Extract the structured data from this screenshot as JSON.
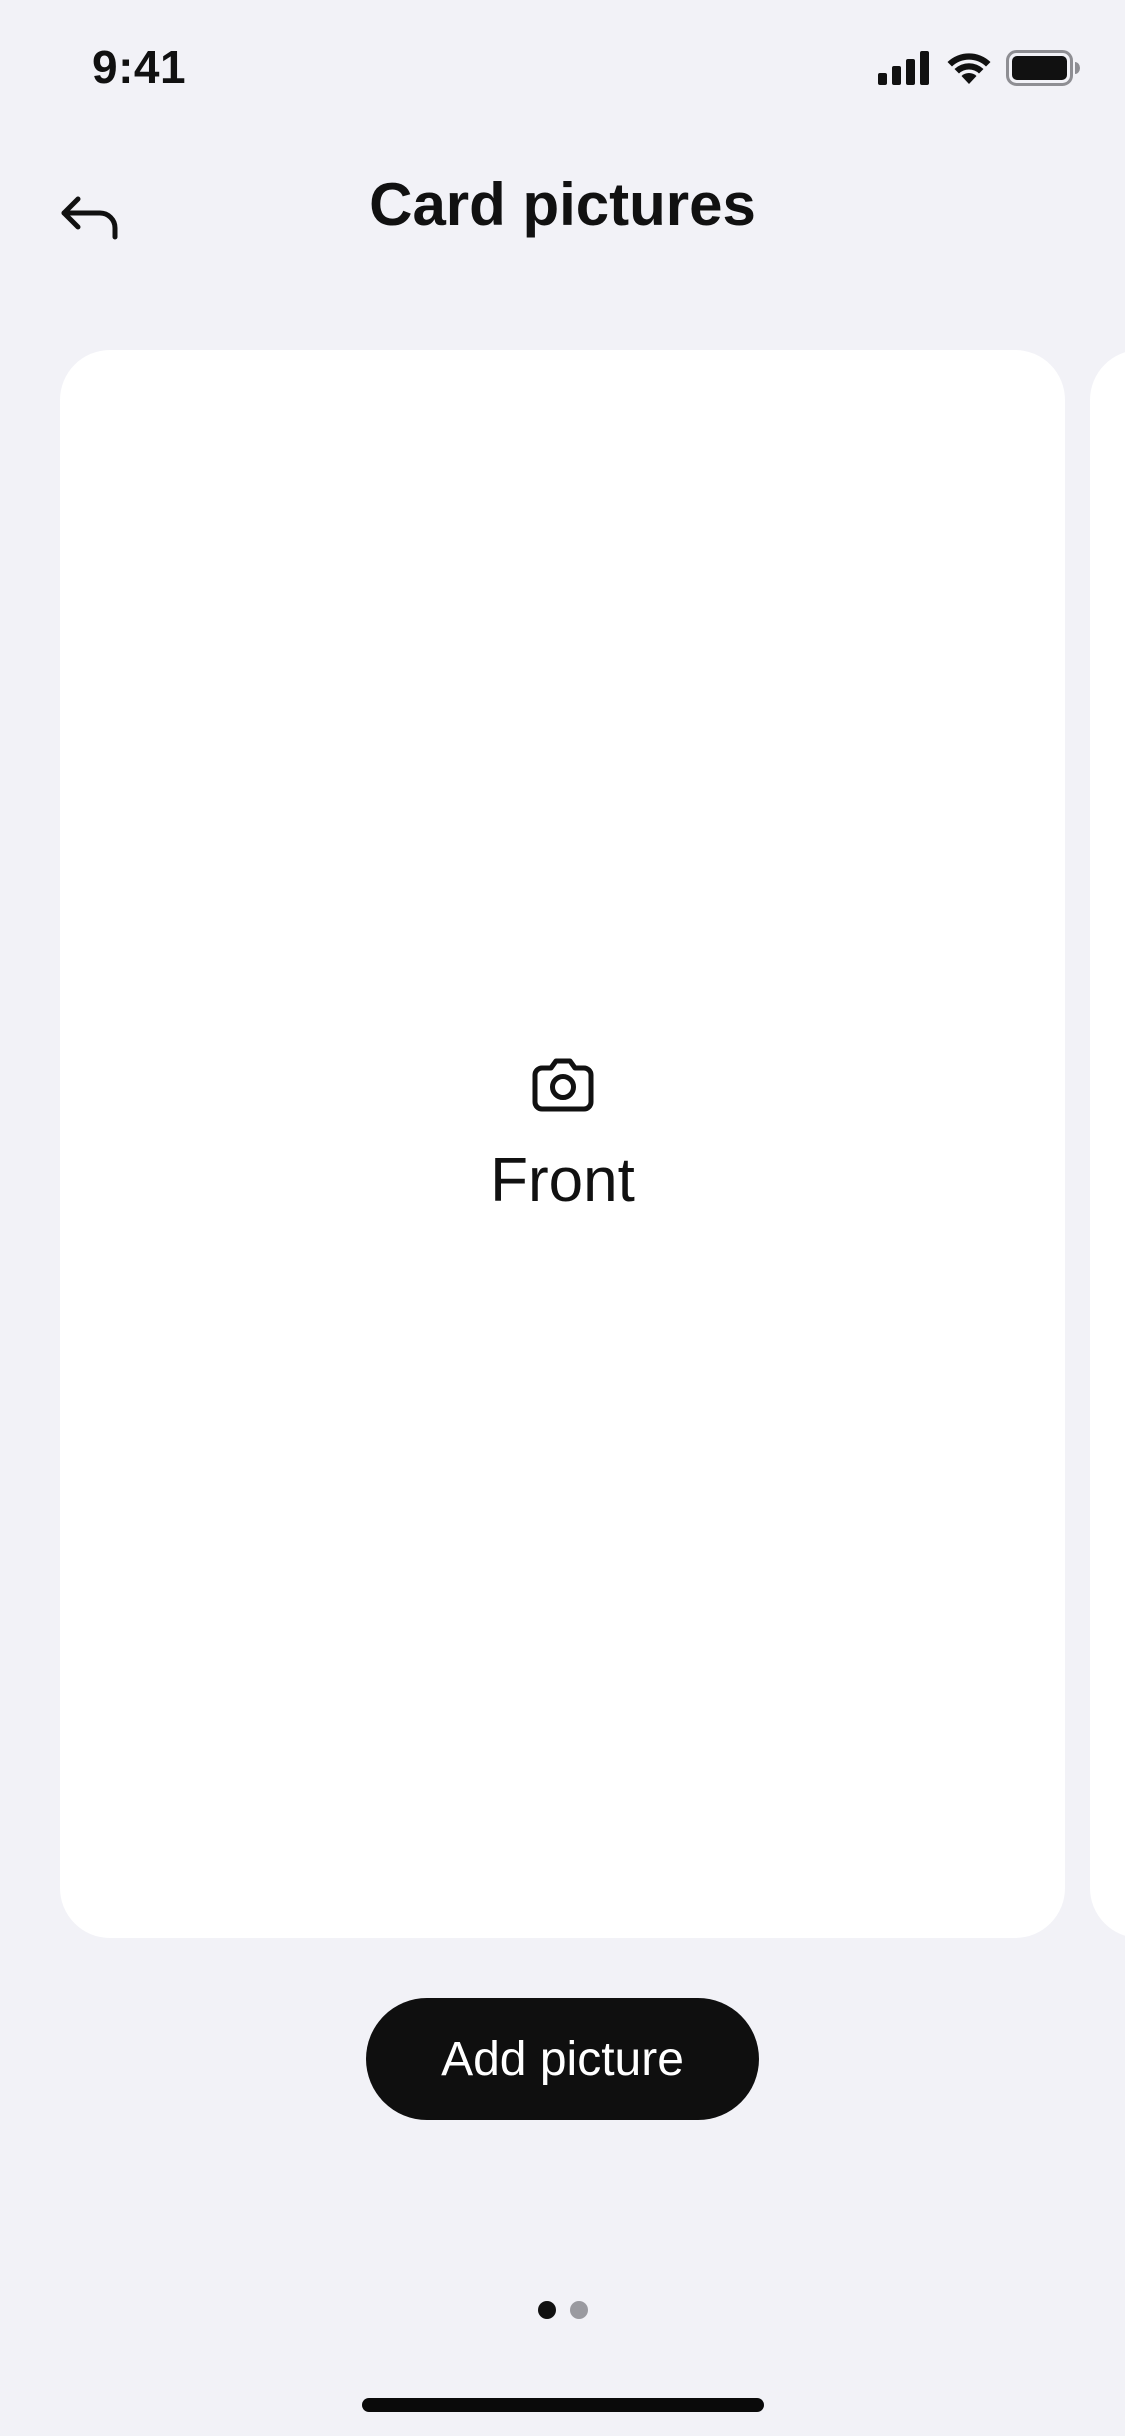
{
  "status_bar": {
    "time": "9:41",
    "icons": [
      "cellular-signal-icon",
      "wifi-icon",
      "battery-icon"
    ]
  },
  "header": {
    "title": "Card pictures",
    "back_icon": "back-arrow-icon"
  },
  "carousel": {
    "cards": [
      {
        "label": "Front",
        "icon": "camera-icon"
      }
    ],
    "page_count": 2,
    "current_page": 1
  },
  "actions": {
    "add_picture_label": "Add picture"
  },
  "colors": {
    "background": "#f2f2f7",
    "card": "#ffffff",
    "primary_button": "#0f0f0f",
    "primary_button_text": "#ffffff",
    "dot_active": "#111111",
    "dot_inactive": "#9a9aa0"
  }
}
